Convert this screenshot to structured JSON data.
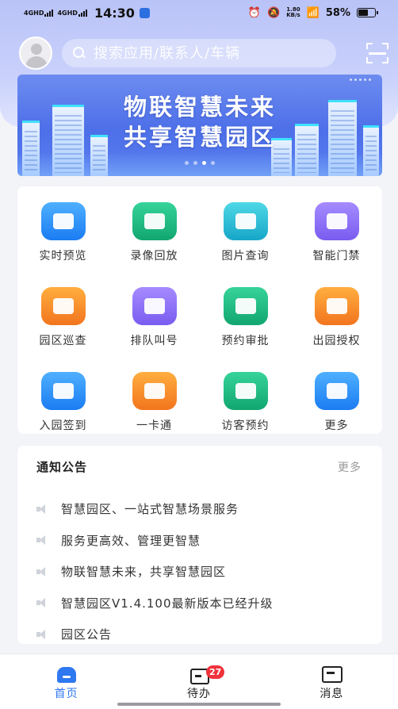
{
  "status_bar": {
    "network_1": "4GHD",
    "network_2": "4GHD",
    "time": "14:30",
    "speed_value": "1.80",
    "speed_unit": "KB/s",
    "battery": "58%",
    "battery_level": 0.58
  },
  "search": {
    "placeholder": "搜索应用/联系人/车辆"
  },
  "banner": {
    "line1": "物联智慧未来",
    "line2": "共享智慧园区",
    "slide_count": 4,
    "active_slide": 3
  },
  "apps": [
    {
      "label": "实时预览",
      "icon": "video-camera-icon",
      "color": "#2b8cf7"
    },
    {
      "label": "录像回放",
      "icon": "playback-icon",
      "color": "#1fbf84"
    },
    {
      "label": "图片查询",
      "icon": "picture-icon",
      "color": "#2bbfd8"
    },
    {
      "label": "智能门禁",
      "icon": "door-icon",
      "color": "#8a6cf5"
    },
    {
      "label": "园区巡查",
      "icon": "patrol-icon",
      "color": "#f78a2a"
    },
    {
      "label": "排队叫号",
      "icon": "queue-icon",
      "color": "#8a6cf5"
    },
    {
      "label": "预约审批",
      "icon": "id-card-icon",
      "color": "#1fbf84"
    },
    {
      "label": "出园授权",
      "icon": "exit-auth-icon",
      "color": "#f78a2a"
    },
    {
      "label": "入园签到",
      "icon": "sign-in-icon",
      "color": "#2b8cf7"
    },
    {
      "label": "一卡通",
      "icon": "card-icon",
      "color": "#f78a2a"
    },
    {
      "label": "访客预约",
      "icon": "visitor-icon",
      "color": "#1fbf84"
    },
    {
      "label": "更多",
      "icon": "more-icon",
      "color": "#2b8cf7"
    }
  ],
  "notice": {
    "title": "通知公告",
    "more": "更多",
    "items": [
      "智慧园区、一站式智慧场景服务",
      "服务更高效、管理更智慧",
      "物联智慧未来，共享智慧园区",
      "智慧园区V1.4.100最新版本已经升级",
      "园区公告"
    ]
  },
  "tabbar": {
    "home": "首页",
    "todo": "待办",
    "todo_badge": "27",
    "messages": "消息"
  },
  "colors": {
    "accent": "#2f78f0",
    "badge": "#f0323c"
  }
}
